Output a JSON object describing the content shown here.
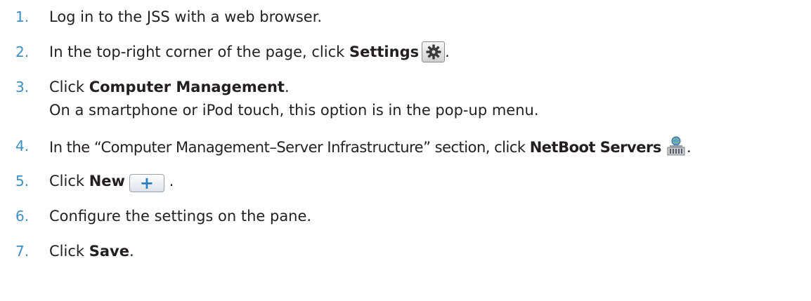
{
  "steps": [
    {
      "num": "1.",
      "text": "Log in to the JSS with a web browser."
    },
    {
      "num": "2.",
      "pre": "In the top-right corner of the page, click ",
      "bold": "Settings",
      "post": "."
    },
    {
      "num": "3.",
      "pre": "Click ",
      "bold": "Computer Management",
      "post": ".",
      "note": "On a smartphone or iPod touch, this option is in the pop-up menu."
    },
    {
      "num": "4.",
      "pre": "In the “Computer Management–Server Infrastructure” section, click ",
      "bold": "NetBoot Servers",
      "post": "."
    },
    {
      "num": "5.",
      "pre": "Click ",
      "bold": "New",
      "post": "."
    },
    {
      "num": "6.",
      "text": "Configure the settings on the pane."
    },
    {
      "num": "7.",
      "pre": "Click ",
      "bold": "Save",
      "post": "."
    }
  ],
  "icons": {
    "settings": "gear-icon",
    "netboot": "netboot-server-icon",
    "new": "plus-icon",
    "accent": "#3b8fc7"
  }
}
